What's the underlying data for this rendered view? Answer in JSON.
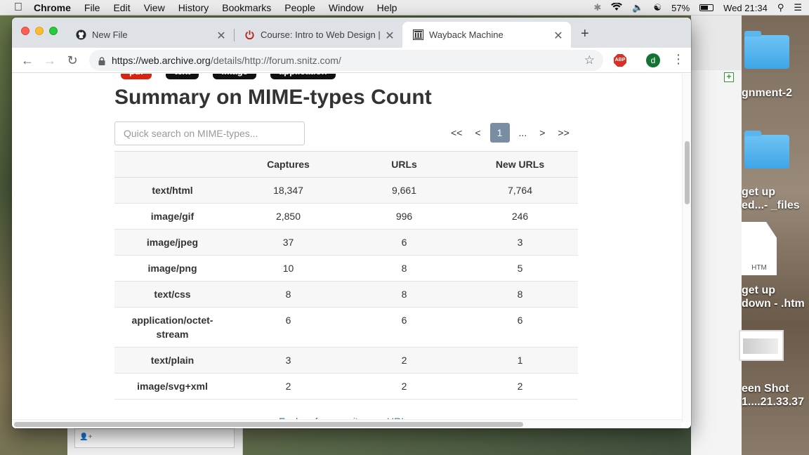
{
  "menubar": {
    "app": "Chrome",
    "items": [
      "File",
      "Edit",
      "View",
      "History",
      "Bookmarks",
      "People",
      "Window",
      "Help"
    ],
    "battery": "57%",
    "clock": "Wed 21:34"
  },
  "browser": {
    "tabs": [
      {
        "label": "New File",
        "icon": "github-icon"
      },
      {
        "label": "Course: Intro to Web Design | I",
        "icon": "power-icon"
      },
      {
        "label": "Wayback Machine",
        "icon": "archive-icon",
        "active": true
      }
    ],
    "url_host": "https://web.archive.org",
    "url_path": "/details/http://forum.snitz.com/",
    "abp_label": "ABP",
    "profile_initial": "d"
  },
  "page": {
    "badges": [
      "pdf",
      "text",
      "image",
      "application"
    ],
    "title": "Summary on MIME-types Count",
    "search_placeholder": "Quick search on MIME-types...",
    "pager": {
      "first": "<<",
      "prev": "<",
      "current": "1",
      "ellipsis": "...",
      "next": ">",
      "last": ">>"
    },
    "table": {
      "headers": [
        "",
        "Captures",
        "URLs",
        "New URLs"
      ],
      "rows": [
        {
          "type": "text/html",
          "captures": "18,347",
          "urls": "9,661",
          "new_urls": "7,764"
        },
        {
          "type": "image/gif",
          "captures": "2,850",
          "urls": "996",
          "new_urls": "246"
        },
        {
          "type": "image/jpeg",
          "captures": "37",
          "urls": "6",
          "new_urls": "3"
        },
        {
          "type": "image/png",
          "captures": "10",
          "urls": "8",
          "new_urls": "5"
        },
        {
          "type": "text/css",
          "captures": "8",
          "urls": "8",
          "new_urls": "8"
        },
        {
          "type": "application/octet-stream",
          "captures": "6",
          "urls": "6",
          "new_urls": "6"
        },
        {
          "type": "text/plain",
          "captures": "3",
          "urls": "2",
          "new_urls": "1"
        },
        {
          "type": "image/svg+xml",
          "captures": "2",
          "urls": "2",
          "new_urls": "2"
        }
      ]
    },
    "explore_link": "Explore forum.snitz.com URLs"
  },
  "desktop": {
    "labels": [
      "gnment-2",
      "get up",
      "ed...- _files",
      "HTM",
      "get up",
      "down - .htm",
      "een Shot",
      "1....21.33.37"
    ]
  },
  "colors": {
    "pager_current": "#7a8ea3",
    "badge_pdf": "#d9230f",
    "avatar": "#137333"
  }
}
